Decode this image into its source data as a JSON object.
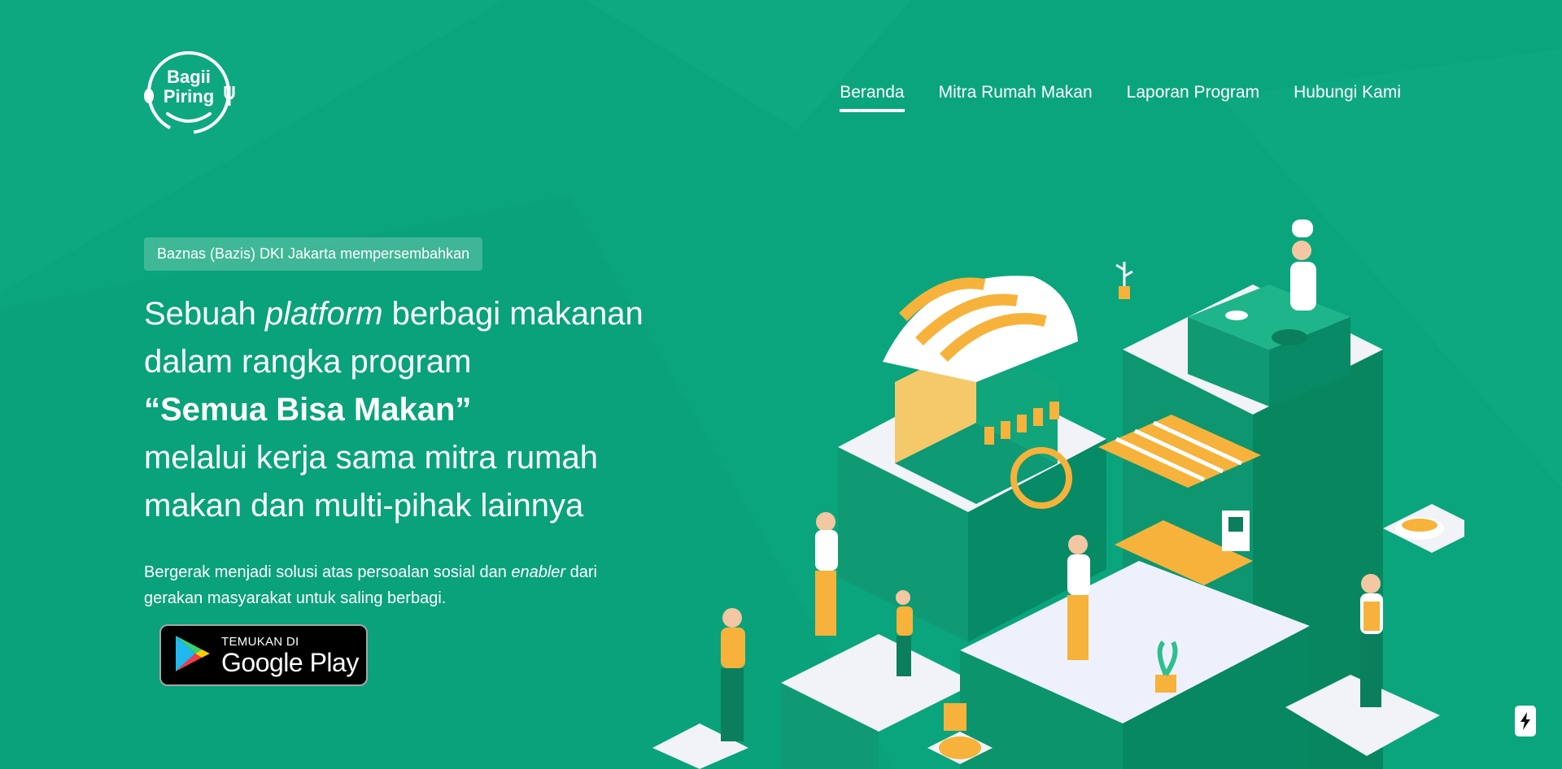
{
  "colors": {
    "background": "#0aa57c",
    "accent_orange": "#f7b23b",
    "white": "#ffffff"
  },
  "logo": {
    "line1": "Bagii",
    "line2": "Piring"
  },
  "nav": {
    "items": [
      {
        "label": "Beranda",
        "active": true
      },
      {
        "label": "Mitra Rumah Makan",
        "active": false
      },
      {
        "label": "Laporan Program",
        "active": false
      },
      {
        "label": "Hubungi Kami",
        "active": false
      }
    ]
  },
  "hero": {
    "badge": "Baznas (Bazis) DKI Jakarta mempersembahkan",
    "headline": {
      "l1_pre": "Sebuah ",
      "l1_em": "platform",
      "l1_post": " berbagi makanan",
      "l2": "dalam rangka program",
      "l3": "“Semua Bisa Makan”",
      "l4": "melalui kerja sama mitra rumah",
      "l5": "makan dan multi-pihak lainnya"
    },
    "sub": {
      "pre": "Bergerak menjadi solusi atas persoalan sosial dan ",
      "em": "enabler",
      "post": " dari gerakan masyarakat untuk saling berbagi."
    }
  },
  "store_button": {
    "small": "TEMUKAN DI",
    "big": "Google Play",
    "icon": "google-play-icon"
  },
  "floating_button": {
    "icon": "lightning-icon"
  }
}
